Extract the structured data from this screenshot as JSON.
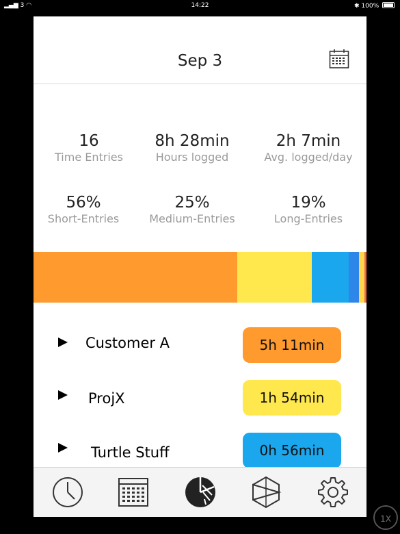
{
  "status_bar": {
    "signal": "3",
    "time": "14:22",
    "battery": "100%"
  },
  "header": {
    "date": "Sep 3",
    "calendar_icon": "calendar-icon"
  },
  "stats": [
    {
      "value": "16",
      "label": "Time Entries"
    },
    {
      "value": "8h 28min",
      "label": "Hours logged"
    },
    {
      "value": "2h 7min",
      "label": "Avg. logged/day"
    },
    {
      "value": "56%",
      "label": "Short-Entries"
    },
    {
      "value": "25%",
      "label": "Medium-Entries"
    },
    {
      "value": "19%",
      "label": "Long-Entries"
    }
  ],
  "distribution_bar": [
    {
      "project": "Customer A",
      "fraction": 0.611,
      "color": "#FF9A2E"
    },
    {
      "project": "ProjX",
      "fraction": 0.225,
      "color": "#FFE84D"
    },
    {
      "project": "Turtle Stuff",
      "fraction": 0.11,
      "color": "#1AA7EE"
    },
    {
      "project": "",
      "fraction": 0.031,
      "color": "#2E86E8"
    },
    {
      "project": "",
      "fraction": 0.016,
      "color": "#FFD54A"
    },
    {
      "project": "",
      "fraction": 0.007,
      "color": "#F06A4B"
    }
  ],
  "projects": [
    {
      "name": "Customer A",
      "duration": "5h 11min",
      "color": "#FF9A2E"
    },
    {
      "name": "ProjX",
      "duration": "1h 54min",
      "color": "#FFE84D"
    },
    {
      "name": "Turtle Stuff",
      "duration": "0h 56min",
      "color": "#1AA7EE"
    }
  ],
  "tabbar": {
    "items": [
      {
        "icon": "clock-icon"
      },
      {
        "icon": "calendar-grid-icon"
      },
      {
        "icon": "pie-chart-icon",
        "active": true
      },
      {
        "icon": "play-hexagon-icon"
      },
      {
        "icon": "gear-icon"
      }
    ]
  },
  "zoom_badge": "1X"
}
